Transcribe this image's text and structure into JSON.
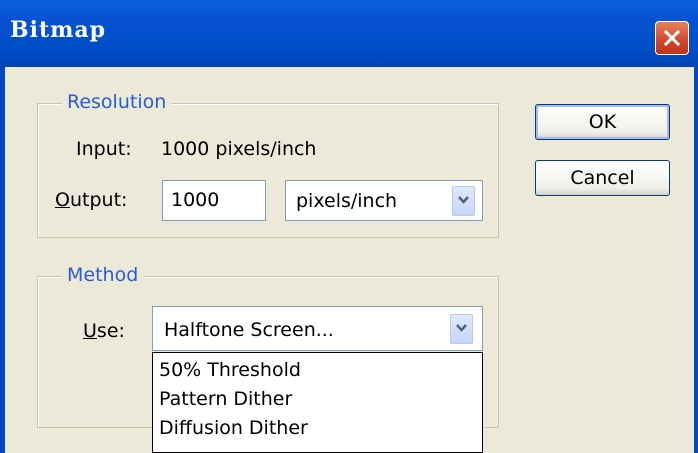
{
  "window": {
    "title": "Bitmap"
  },
  "resolution": {
    "legend": "Resolution",
    "input_label": "Input:",
    "input_value": "1000 pixels/inch",
    "output_label_mnemonic": "O",
    "output_label_rest": "utput:",
    "output_value": "1000",
    "unit_selected": "pixels/inch"
  },
  "method": {
    "legend": "Method",
    "use_label_mnemonic": "U",
    "use_label_rest": "se:",
    "use_selected": "Halftone Screen...",
    "options": [
      "50% Threshold",
      "Pattern Dither",
      "Diffusion Dither"
    ]
  },
  "buttons": {
    "ok": "OK",
    "cancel": "Cancel"
  },
  "colors": {
    "titlebar": "#0a5fdc",
    "dialog_bg": "#ece9d8",
    "legend_text": "#2a5bd7",
    "close_button": "#d2452a"
  }
}
